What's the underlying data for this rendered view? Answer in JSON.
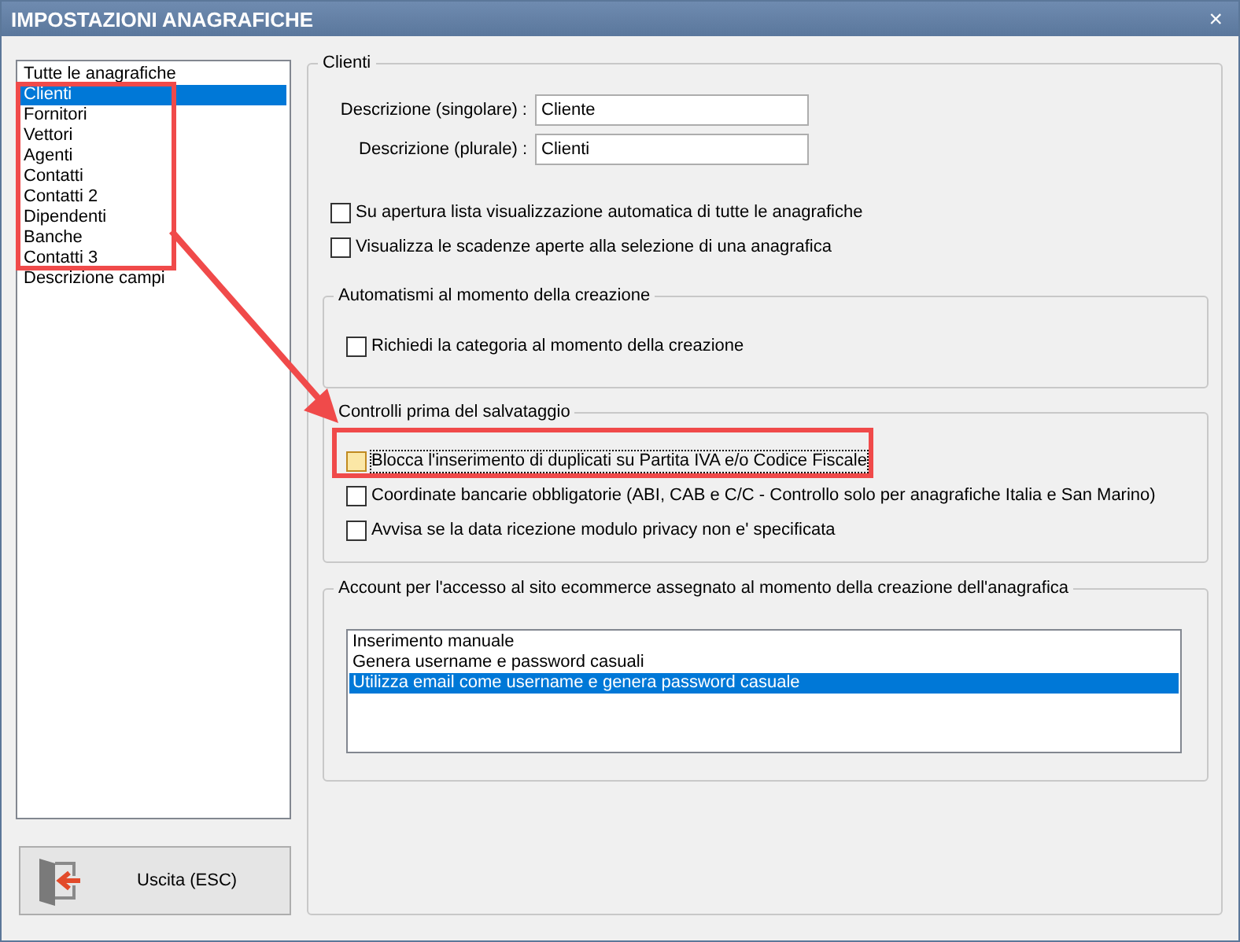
{
  "window": {
    "title": "IMPOSTAZIONI ANAGRAFICHE",
    "close": "×"
  },
  "sidebar": {
    "items": [
      {
        "label": "Tutte le anagrafiche",
        "selected": false
      },
      {
        "label": "Clienti",
        "selected": true
      },
      {
        "label": "Fornitori",
        "selected": false
      },
      {
        "label": "Vettori",
        "selected": false
      },
      {
        "label": "Agenti",
        "selected": false
      },
      {
        "label": "Contatti",
        "selected": false
      },
      {
        "label": "Contatti 2",
        "selected": false
      },
      {
        "label": "Dipendenti",
        "selected": false
      },
      {
        "label": "Banche",
        "selected": false
      },
      {
        "label": "Contatti 3",
        "selected": false
      },
      {
        "label": "Descrizione campi",
        "selected": false
      }
    ]
  },
  "exit_button": {
    "label": "Uscita (ESC)"
  },
  "panel": {
    "title": "Clienti",
    "fields": [
      {
        "label": "Descrizione (singolare) :",
        "value": "Cliente"
      },
      {
        "label": "Descrizione (plurale) :",
        "value": "Clienti"
      }
    ],
    "options": [
      {
        "label": "Su apertura lista visualizzazione automatica di tutte le anagrafiche",
        "checked": false,
        "focused": false
      },
      {
        "label": "Visualizza le scadenze aperte alla selezione di una anagrafica",
        "checked": false,
        "focused": false
      }
    ],
    "groups": [
      {
        "title": "Automatismi al momento della creazione",
        "options": [
          {
            "label": "Richiedi la categoria al momento della creazione",
            "checked": false,
            "focused": false
          }
        ]
      },
      {
        "title": "Controlli prima del salvataggio",
        "options": [
          {
            "label": "Blocca l'inserimento di duplicati su Partita IVA e/o Codice Fiscale",
            "checked": false,
            "focused": true
          },
          {
            "label": "Coordinate bancarie obbligatorie (ABI, CAB e C/C - Controllo solo per anagrafiche Italia e San Marino)",
            "checked": false,
            "focused": false
          },
          {
            "label": "Avvisa se la data ricezione modulo privacy non e' specificata",
            "checked": false,
            "focused": false
          }
        ]
      }
    ],
    "account": {
      "title": "Account per l'accesso al sito ecommerce assegnato al momento della creazione dell'anagrafica",
      "items": [
        {
          "label": "Inserimento manuale",
          "selected": false
        },
        {
          "label": "Genera username e password casuali",
          "selected": false
        },
        {
          "label": "Utilizza email come username e genera password casuale",
          "selected": true
        }
      ]
    }
  }
}
